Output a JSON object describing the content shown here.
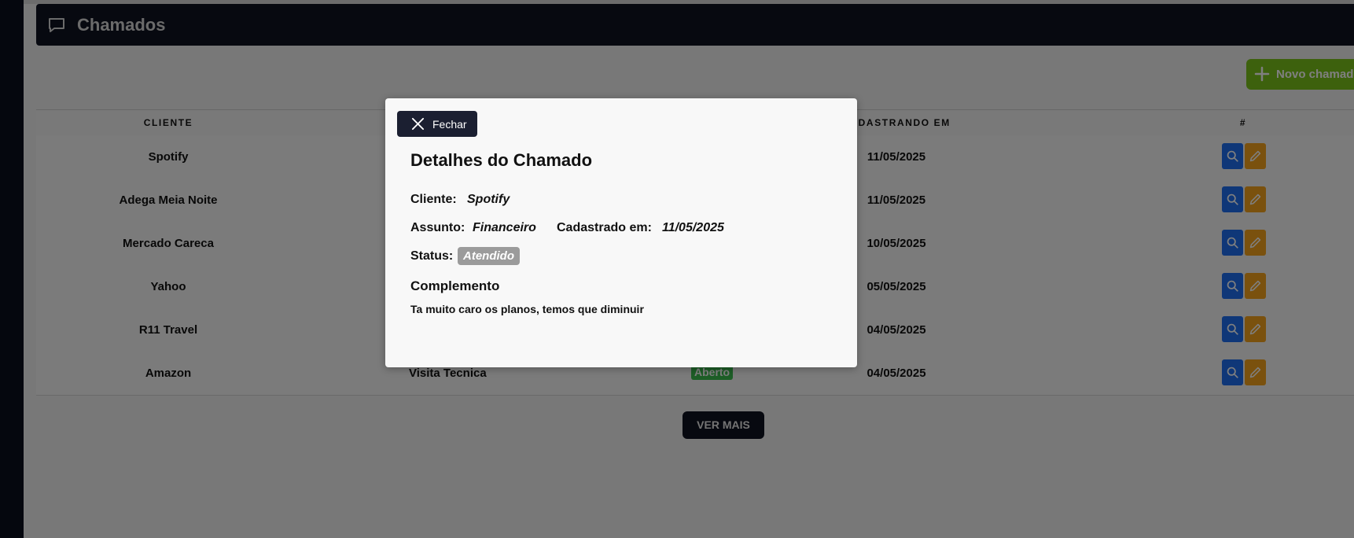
{
  "header": {
    "title": "Chamados",
    "icon": "chat-bubble-icon"
  },
  "actions": {
    "new_label": "Novo chamado"
  },
  "table": {
    "headers": {
      "cliente": "CLIENTE",
      "cadastrado": "CADASTRANDO EM",
      "acoes": "#"
    },
    "rows": [
      {
        "cliente": "Spotify",
        "assunto": "",
        "status": "",
        "data": "11/05/2025"
      },
      {
        "cliente": "Adega Meia Noite",
        "assunto": "",
        "status": "",
        "data": "11/05/2025"
      },
      {
        "cliente": "Mercado Careca",
        "assunto": "",
        "status": "",
        "data": "10/05/2025"
      },
      {
        "cliente": "Yahoo",
        "assunto": "",
        "status": "",
        "data": "05/05/2025"
      },
      {
        "cliente": "R11 Travel",
        "assunto": "",
        "status": "",
        "data": "04/05/2025"
      },
      {
        "cliente": "Amazon",
        "assunto": "Visita Tecnica",
        "status": "Aberto",
        "data": "04/05/2025"
      }
    ]
  },
  "pagination": {
    "ver_mais": "VER MAIS"
  },
  "modal": {
    "close_label": "Fechar",
    "title": "Detalhes do Chamado",
    "cliente_label": "Cliente:",
    "cliente_value": "Spotify",
    "assunto_label": "Assunto:",
    "assunto_value": "Financeiro",
    "cadastrado_label": "Cadastrado em:",
    "cadastrado_value": "11/05/2025",
    "status_label": "Status:",
    "status_value": "Atendido",
    "complemento_title": "Complemento",
    "complemento_text": "Ta muito caro os planos, temos que diminuir"
  },
  "colors": {
    "sidebar": "#0b0f1c",
    "header": "#0f1320",
    "new_button": "#7bc21a",
    "view_button": "#1f6ff0",
    "edit_button": "#f4a21c",
    "status_open": "#3bbd4e",
    "status_attended": "#9b9b9b"
  }
}
